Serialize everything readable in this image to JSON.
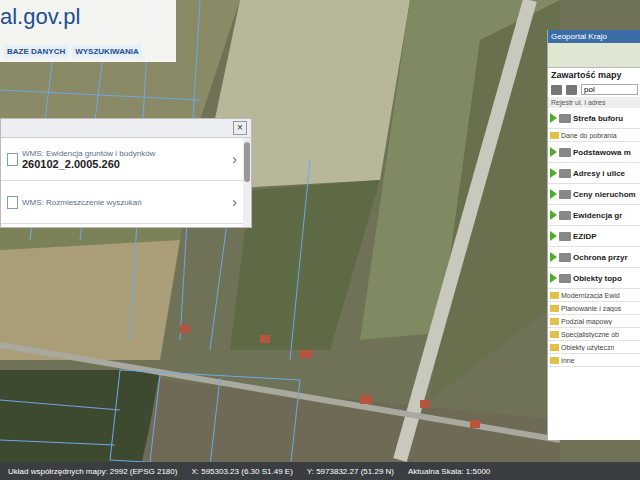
{
  "header": {
    "site": "al.gov.pl",
    "nav": [
      {
        "label": "BAZE DANYCH"
      },
      {
        "label": "WYSZUKIWANIA"
      }
    ]
  },
  "popup": {
    "close": "×",
    "items": [
      {
        "layer": "WMS: Ewidencja gruntów i budynków",
        "value": "260102_2.0005.260",
        "chevron": "›"
      },
      {
        "layer": "WMS: Rozmieszczenie wyszukań",
        "value": "",
        "chevron": "›"
      }
    ]
  },
  "panel": {
    "title": "Geoportal Krajo",
    "section": "Zawartość mapy",
    "search_value": "pol",
    "list_header": "Rejestr ul. i adres",
    "items": [
      {
        "label": "Strefa buforu",
        "kind": "layer",
        "visible": true
      },
      {
        "label": "Dane do pobrania",
        "kind": "folder",
        "visible": false
      },
      {
        "label": "Podstawowa m",
        "kind": "layer",
        "visible": true
      },
      {
        "label": "Adresy i ulice",
        "kind": "layer",
        "visible": true
      },
      {
        "label": "Ceny nieruchom",
        "kind": "layer",
        "visible": true
      },
      {
        "label": "Ewidencja gr",
        "kind": "layer",
        "visible": true
      },
      {
        "label": "EZIDP",
        "kind": "layer",
        "visible": true
      },
      {
        "label": "Ochrona przyr",
        "kind": "layer",
        "visible": true
      },
      {
        "label": "Obiekty topo",
        "kind": "layer",
        "visible": true
      },
      {
        "label": "Modernizacja Ewid",
        "kind": "folder",
        "visible": false
      },
      {
        "label": "Planowanie i zagos",
        "kind": "folder",
        "visible": false
      },
      {
        "label": "Podział mapowy",
        "kind": "folder",
        "visible": false
      },
      {
        "label": "Specjalistyczne ob",
        "kind": "folder",
        "visible": false
      },
      {
        "label": "Obiekty użyteczn",
        "kind": "folder",
        "visible": false
      },
      {
        "label": "Inne",
        "kind": "folder",
        "visible": false
      }
    ]
  },
  "status_bar": [
    {
      "text": "Układ współrzędnych mapy: 2992 (EPSG 2180)"
    },
    {
      "text": "X: 595303.23 (6.30 S1.49 E)"
    },
    {
      "text": "Y: 5973832.27 (51.29 N)"
    },
    {
      "text": "Aktualna Skala: 1:5000"
    }
  ]
}
